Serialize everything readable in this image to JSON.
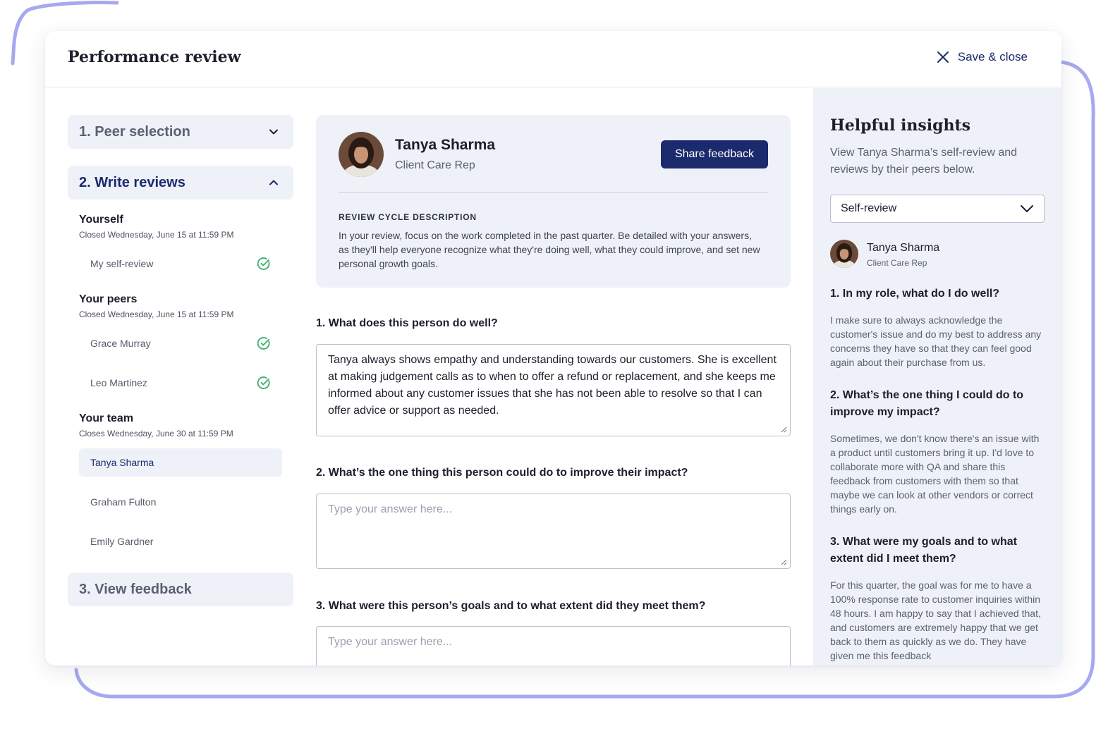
{
  "header": {
    "title": "Performance review",
    "save_close_label": "Save & close"
  },
  "steps": {
    "peer_selection": "1. Peer selection",
    "write_reviews": "2. Write reviews",
    "view_feedback": "3. View feedback"
  },
  "groups": {
    "yourself": {
      "title": "Yourself",
      "subtitle": "Closed Wednesday, June 15 at 11:59 PM",
      "items": [
        "My self-review"
      ]
    },
    "peers": {
      "title": "Your peers",
      "subtitle": "Closed Wednesday, June 15 at 11:59 PM",
      "items": [
        "Grace Murray",
        "Leo Martinez"
      ]
    },
    "team": {
      "title": "Your team",
      "subtitle": "Closes Wednesday, June 30 at 11:59 PM",
      "items": [
        "Tanya Sharma",
        "Graham Fulton",
        "Emily Gardner"
      ]
    }
  },
  "profile": {
    "name": "Tanya Sharma",
    "role": "Client Care Rep",
    "share_label": "Share feedback",
    "cycle_label": "REVIEW CYCLE DESCRIPTION",
    "cycle_text": "In your review, focus on the work completed in the past quarter. Be detailed with your answers, as they'll help everyone recognize what they're doing well, what they could improve, and set new personal growth goals."
  },
  "questions": [
    {
      "label": "1. What does this person do well?",
      "value": "Tanya always shows empathy and understanding towards our customers. She is excellent at making judgement calls as to when to offer a refund or replacement, and she keeps me informed about any customer issues that she has not been able to resolve so that I can offer advice or support as needed."
    },
    {
      "label": "2. What’s the one thing this person could do to improve their impact?",
      "placeholder": "Type your answer here..."
    },
    {
      "label": "3. What were this person’s goals and to what extent did they meet them?",
      "placeholder": "Type your answer here..."
    }
  ],
  "insights": {
    "title": "Helpful insights",
    "description": "View Tanya Sharma’s self-review and reviews by their peers below.",
    "select_value": "Self-review",
    "reviewer_name": "Tanya Sharma",
    "reviewer_role": "Client Care Rep",
    "qa": [
      {
        "q": "1. In my role, what do I do well?",
        "a": "I make sure to always acknowledge the customer's issue and do my best to address any concerns they have so that they can feel good again about their purchase from us."
      },
      {
        "q": "2. What’s the one thing I could do to improve my impact?",
        "a": "Sometimes, we don't know there's an issue with a product until customers bring it up. I'd love to collaborate more with QA and share this feedback from customers with them so that maybe we can look at other vendors or correct things early on."
      },
      {
        "q": "3. What were my goals and to what extent did I meet them?",
        "a": "For this quarter, the goal was for me to have a 100% response rate to customer inquiries within 48 hours. I am happy to say that I achieved that, and customers are extremely happy that we get back to them as quickly as we do. They have given me this feedback"
      }
    ]
  },
  "colors": {
    "accent": "#1a2a6c",
    "panel": "#eef1f8",
    "check": "#3fae6a",
    "decor": "#a7a9f0"
  },
  "icons": [
    "close-icon",
    "chevron-down-icon",
    "chevron-up-icon",
    "check-circle-icon",
    "resize-grip-icon"
  ]
}
